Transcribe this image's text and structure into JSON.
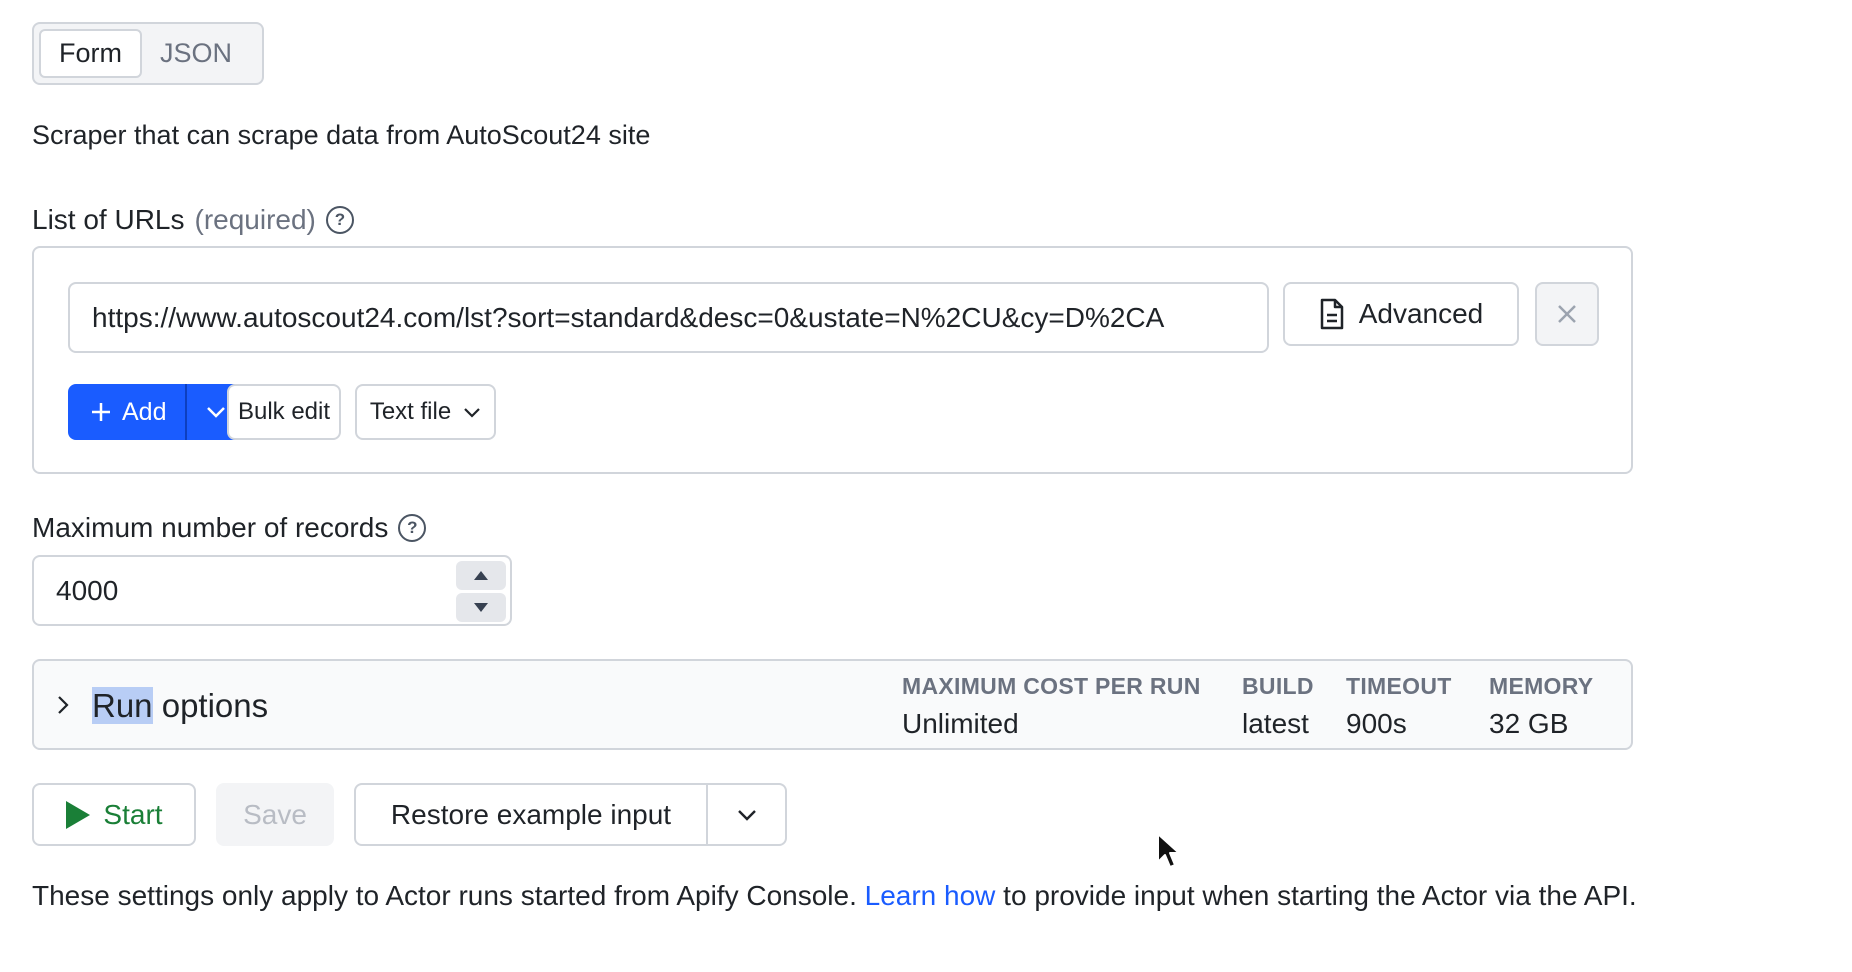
{
  "toggle": {
    "form": "Form",
    "json": "JSON"
  },
  "description": "Scraper that can scrape data from AutoScout24 site",
  "urls": {
    "label": "List of URLs",
    "required": "(required)",
    "value": "https://www.autoscout24.com/lst?sort=standard&desc=0&ustate=N%2CU&cy=D%2CA",
    "advanced_label": "Advanced",
    "add_label": "Add",
    "bulk_edit_label": "Bulk edit",
    "text_file_label": "Text file"
  },
  "max_records": {
    "label": "Maximum number of records",
    "value": "4000"
  },
  "run_options": {
    "title_highlight": "Run",
    "title_rest": " options",
    "stats": [
      {
        "key": "MAXIMUM COST PER RUN",
        "value": "Unlimited"
      },
      {
        "key": "BUILD",
        "value": "latest"
      },
      {
        "key": "TIMEOUT",
        "value": "900s"
      },
      {
        "key": "MEMORY",
        "value": "32 GB"
      }
    ]
  },
  "actions": {
    "start": "Start",
    "save": "Save",
    "restore": "Restore example input"
  },
  "note": {
    "before": "These settings only apply to Actor runs started from Apify Console. ",
    "link": "Learn how",
    "after": " to provide input when starting the Actor via the API."
  },
  "colors": {
    "primary": "#1a5cff",
    "start_green": "#1a7f37",
    "highlight": "#b8cdf5"
  },
  "icons": [
    "help-icon",
    "document-icon",
    "close-icon",
    "plus-icon",
    "chevron-down-icon",
    "chevron-right-icon",
    "play-icon",
    "caret-up-icon",
    "caret-down-icon",
    "mouse-cursor-icon"
  ]
}
